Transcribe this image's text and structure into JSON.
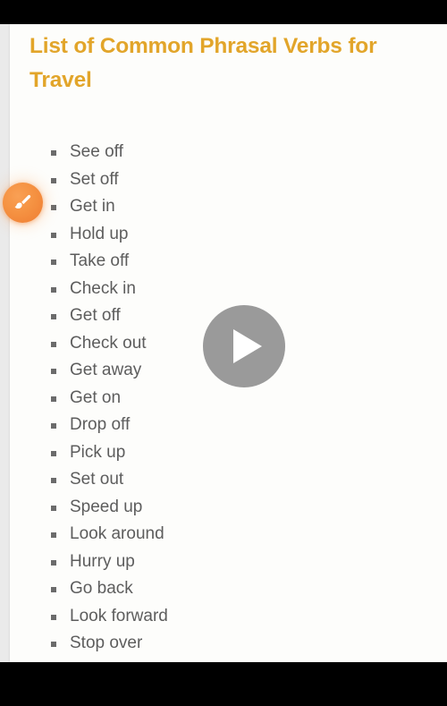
{
  "article": {
    "title": "List of Common Phrasal Verbs for Travel",
    "title_color": "#e2a52a",
    "body_text_color": "#5d5d5d",
    "bullet_color": "#6b6b6b",
    "items": [
      "See off",
      "Set off",
      "Get in",
      "Hold up",
      "Take off",
      "Check in",
      "Get off",
      "Check out",
      "Get away",
      "Get on",
      "Drop off",
      "Pick up",
      "Set out",
      "Speed up",
      "Look around",
      "Hurry up",
      "Go back",
      "Look forward",
      "Stop over"
    ]
  },
  "overlays": {
    "paint_button": {
      "icon": "paintbrush-icon",
      "color": "#f28a3c"
    },
    "play_button": {
      "icon": "play-icon",
      "color": "#9a9a9a"
    }
  },
  "chrome": {
    "letterbox_color": "#000000",
    "page_background": "#eaeaea",
    "card_background": "#fdfdfb"
  }
}
